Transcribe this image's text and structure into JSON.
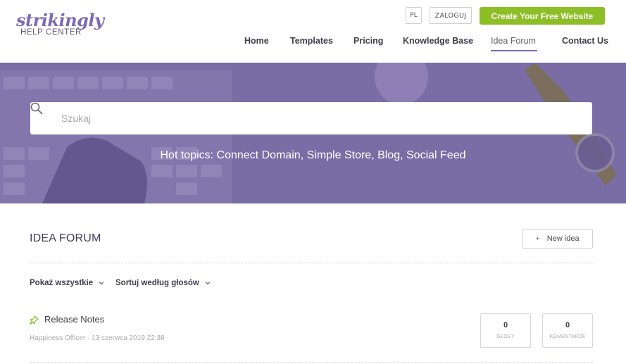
{
  "brand": {
    "name": "strikingly",
    "subtitle": "HELP CENTER",
    "accent": "#7b6bb4",
    "cta_color": "#8cbf26"
  },
  "topbar": {
    "lang": "PL",
    "login": "ZALOGUJ",
    "cta": "Create Your Free Website"
  },
  "nav": {
    "items": [
      "Home",
      "Templates",
      "Pricing",
      "Knowledge Base",
      "Idea Forum",
      "Contact Us"
    ],
    "active": "Idea Forum"
  },
  "hero": {
    "search_placeholder": "Szukaj",
    "hot_topics": "Hot topics: Connect Domain, Simple Store, Blog, Social Feed"
  },
  "forum": {
    "title": "IDEA FORUM",
    "new_idea": "New idea",
    "new_idea_icon": "plus-icon",
    "filters": {
      "show": "Pokaż wszystkie",
      "sort": "Sortuj według głosów"
    },
    "posts": [
      {
        "icon": "pin-icon",
        "title": "Release Notes",
        "author": "Happiness Officer",
        "date": "13 czerwca 2019 22:38",
        "votes": "0",
        "votes_label": "GŁOSY",
        "comments": "0",
        "comments_label": "KOMENTARZE"
      }
    ]
  }
}
